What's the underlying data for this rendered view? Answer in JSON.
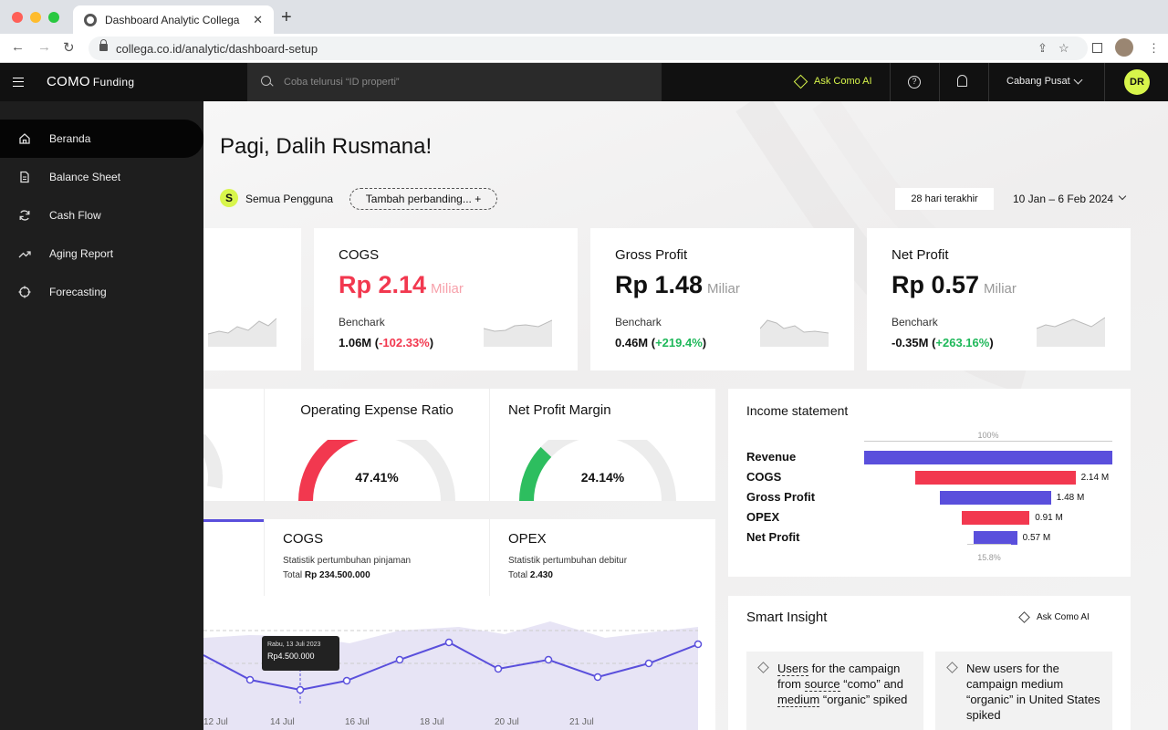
{
  "browser": {
    "tab_title": "Dashboard Analytic Collega",
    "tab_close": "✕",
    "new_tab": "+",
    "url": "collega.co.id/analytic/dashboard-setup",
    "back": "←",
    "forward": "→",
    "reload": "↻"
  },
  "header": {
    "logo": "COMO",
    "logo_sub": "Funding",
    "search_placeholder": "Coba telurusi “ID properti”",
    "ask_ai": "Ask Como AI",
    "help": "?",
    "branch": "Cabang Pusat",
    "avatar": "DR"
  },
  "sidebar": {
    "items": [
      {
        "label": "Beranda",
        "icon": "home-icon",
        "active": true
      },
      {
        "label": "Balance Sheet",
        "icon": "document-icon"
      },
      {
        "label": "Cash Flow",
        "icon": "refresh-icon"
      },
      {
        "label": "Aging Report",
        "icon": "trend-icon"
      },
      {
        "label": "Forecasting",
        "icon": "target-icon"
      }
    ]
  },
  "main": {
    "greeting": "Pagi, Dalih Rusmana!",
    "user_badge": "S",
    "users_filter": "Semua Pengguna",
    "compare": "Tambah perbanding...  +",
    "period": "28 hari terakhir",
    "date_range": "10 Jan – 6 Feb 2024"
  },
  "kpis": [
    {
      "title": "COGS",
      "value": "Rp 2.14",
      "unit": "Miliar",
      "bench_label": "Benchark",
      "bench_value": "1.06M (",
      "bench_change": "-102.33%",
      "bench_close": ")"
    },
    {
      "title": "Gross Profit",
      "value": "Rp 1.48",
      "unit": "Miliar",
      "bench_label": "Benchark",
      "bench_value": "0.46M (",
      "bench_change": "+219.4%",
      "bench_close": ")"
    },
    {
      "title": "Net Profit",
      "value": "Rp 0.57",
      "unit": "Miliar",
      "bench_label": "Benchark",
      "bench_value": "-0.35M (",
      "bench_change": "+263.16%",
      "bench_close": ")"
    }
  ],
  "gauges": [
    {
      "title": "Operating Expense Ratio",
      "value": "47.41%",
      "percent": 47.41,
      "color": "#f2384f"
    },
    {
      "title": "Net Profit Margin",
      "value": "24.14%",
      "percent": 24.14,
      "color": "#2dbe5f"
    }
  ],
  "stats": [
    {
      "title": "COGS",
      "desc": "Statistik pertumbuhan pinjaman",
      "total_label": "Total",
      "total": "Rp 234.500.000"
    },
    {
      "title": "OPEX",
      "desc": "Statistik pertumbuhan debitur",
      "total_label": "Total",
      "total": "2.430"
    }
  ],
  "income": {
    "title": "Income statement",
    "top_label": "100%",
    "bottom_label": "15.8%",
    "rows": [
      {
        "label": "Revenue",
        "value": "",
        "pct": 100,
        "color": "#5a4fdc"
      },
      {
        "label": "COGS",
        "value": "2.14 M",
        "pct": 64.4,
        "color": "#f2384f"
      },
      {
        "label": "Gross Profit",
        "value": "1.48 M",
        "pct": 44.7,
        "color": "#5a4fdc"
      },
      {
        "label": "OPEX",
        "value": "0.91 M",
        "pct": 27.4,
        "color": "#f2384f"
      },
      {
        "label": "Net Profit",
        "value": "0.57 M",
        "pct": 17.4,
        "color": "#5a4fdc"
      }
    ]
  },
  "insight": {
    "title": "Smart Insight",
    "ask_ai": "Ask Como AI",
    "cards": [
      {
        "html": "<u>Users</u> for the campaign from <u>source</u> “como” and <u>medium</u> “organic” spiked"
      },
      {
        "html": "New users for the campaign medium “organic” in United States spiked"
      }
    ]
  },
  "chart_data": {
    "type": "line",
    "x": [
      "12 Jul",
      "14 Jul",
      "16 Jul",
      "18 Jul",
      "20 Jul",
      "21 Jul"
    ],
    "tooltip": {
      "date": "Rabu, 13 Juli 2023",
      "value": "Rp4.500.000"
    }
  },
  "colors": {
    "accent": "#d8f54b",
    "purple": "#5a4fdc",
    "red": "#f2384f",
    "green": "#2dbe5f"
  }
}
